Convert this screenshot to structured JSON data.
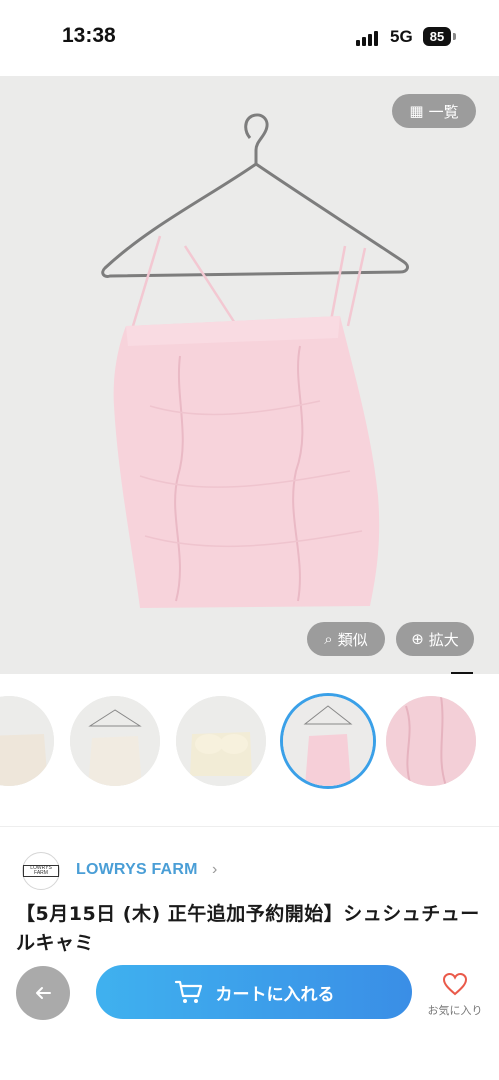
{
  "status_bar": {
    "time": "13:38",
    "network": "5G",
    "battery": "85"
  },
  "hero": {
    "list_button": "一覧",
    "similar_button": "類似",
    "zoom_button": "拡大"
  },
  "thumbnails": [
    {
      "name": "thumb-ivory-back"
    },
    {
      "name": "thumb-ivory-front"
    },
    {
      "name": "thumb-ivory-cups"
    },
    {
      "name": "thumb-pink-front",
      "active": true
    },
    {
      "name": "thumb-pink-detail"
    }
  ],
  "brand": {
    "logo_text": "LOWRYS FARM",
    "name": "LOWRYS FARM"
  },
  "product": {
    "title": "【5月15日 (木) 正午追加予約開始】シュシュチュールキャミ"
  },
  "bottom_bar": {
    "cart_label": "カートに入れる",
    "favorite_label": "お気に入り"
  },
  "colors": {
    "accent": "#3a9ee6",
    "brand": "#4a9ed6",
    "product_pink": "#f6cfd8"
  }
}
